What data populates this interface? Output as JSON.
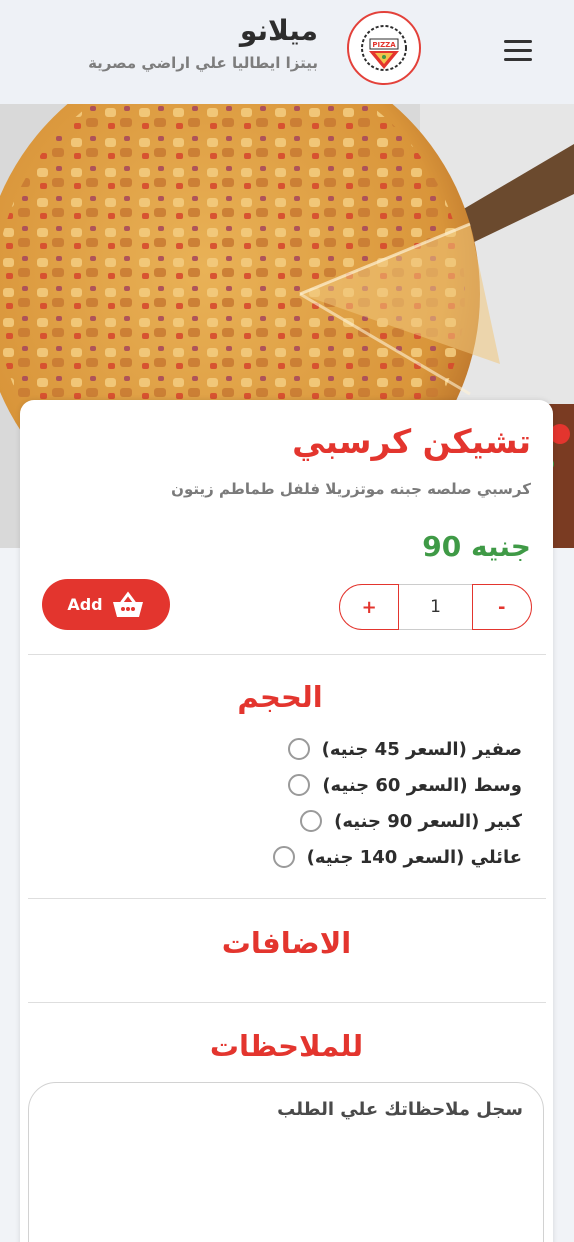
{
  "header": {
    "brand_name": "ميلانو",
    "tagline": "بيتزا ايطاليا علي اراضي مصرية",
    "logo_text": "PIZZA"
  },
  "product": {
    "title": "تشيكن كرسبي",
    "description": "كرسبي صلصه جبنه موتزريلا فلفل طماطم زيتون",
    "price": "90 جنيه"
  },
  "cart": {
    "add_label": "Add",
    "quantity": "1",
    "plus_label": "+",
    "minus_label": "-"
  },
  "sections": {
    "size_title": "الحجم",
    "extras_title": "الاضافات",
    "notes_title": "للملاحظات"
  },
  "size_options": [
    {
      "label": "صفير (السعر 45 جنيه)"
    },
    {
      "label": "وسط (السعر 60 جنيه)"
    },
    {
      "label": "كبير (السعر 90 جنيه)"
    },
    {
      "label": "عائلي (السعر 140 جنيه)"
    }
  ],
  "notes": {
    "placeholder": "سجل ملاحظاتك علي الطلب"
  },
  "colors": {
    "accent": "#e3352e",
    "price": "#3f9a46",
    "background": "#f1f3f7"
  }
}
